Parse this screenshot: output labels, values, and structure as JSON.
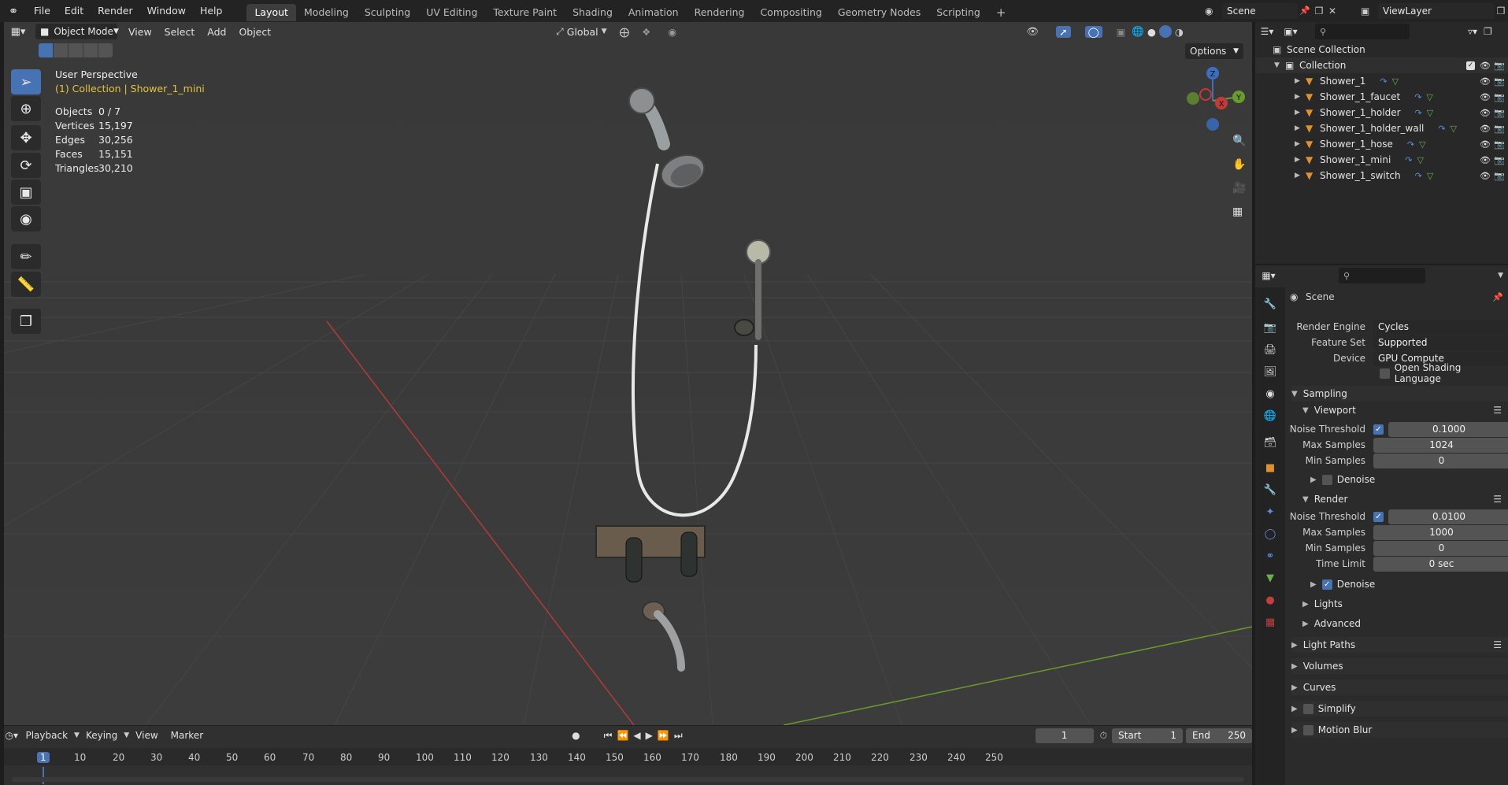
{
  "menu": {
    "items": [
      "File",
      "Edit",
      "Render",
      "Window",
      "Help"
    ]
  },
  "workspaces": {
    "tabs": [
      "Layout",
      "Modeling",
      "Sculpting",
      "UV Editing",
      "Texture Paint",
      "Shading",
      "Animation",
      "Rendering",
      "Compositing",
      "Geometry Nodes",
      "Scripting"
    ],
    "add": "+"
  },
  "scene": {
    "name": "Scene"
  },
  "view_layer": {
    "name": "ViewLayer"
  },
  "viewport_header": {
    "mode": "Object Mode",
    "view": "View",
    "select": "Select",
    "add": "Add",
    "object": "Object",
    "orientation": "Global",
    "options": "Options"
  },
  "overlay_text": {
    "perspective": "User Perspective",
    "context": "(1) Collection | Shower_1_mini"
  },
  "stats": [
    {
      "label": "Objects",
      "value": "0 / 7"
    },
    {
      "label": "Vertices",
      "value": "15,197"
    },
    {
      "label": "Edges",
      "value": "30,256"
    },
    {
      "label": "Faces",
      "value": "15,151"
    },
    {
      "label": "Triangles",
      "value": "30,210"
    }
  ],
  "gizmo": {
    "z": "Z",
    "y": "Y",
    "x": "X"
  },
  "outliner": {
    "root": "Scene Collection",
    "collection": "Collection",
    "objects": [
      "Shower_1",
      "Shower_1_faucet",
      "Shower_1_holder",
      "Shower_1_holder_wall",
      "Shower_1_hose",
      "Shower_1_mini",
      "Shower_1_switch"
    ]
  },
  "properties": {
    "context": "Scene",
    "render_engine_label": "Render Engine",
    "render_engine": "Cycles",
    "feature_set_label": "Feature Set",
    "feature_set": "Supported",
    "device_label": "Device",
    "device": "GPU Compute",
    "osl": "Open Shading Language",
    "sampling": "Sampling",
    "viewport": {
      "title": "Viewport",
      "noise_threshold_label": "Noise Threshold",
      "noise_threshold": "0.1000",
      "max_samples_label": "Max Samples",
      "max_samples": "1024",
      "min_samples_label": "Min Samples",
      "min_samples": "0",
      "denoise": "Denoise"
    },
    "render": {
      "title": "Render",
      "noise_threshold_label": "Noise Threshold",
      "noise_threshold": "0.0100",
      "max_samples_label": "Max Samples",
      "max_samples": "1000",
      "min_samples_label": "Min Samples",
      "min_samples": "0",
      "time_limit_label": "Time Limit",
      "time_limit": "0 sec",
      "denoise": "Denoise"
    },
    "lights": "Lights",
    "advanced": "Advanced",
    "light_paths": "Light Paths",
    "volumes": "Volumes",
    "curves": "Curves",
    "simplify": "Simplify",
    "motion_blur": "Motion Blur"
  },
  "timeline": {
    "playback": "Playback",
    "keying": "Keying",
    "view": "View",
    "marker": "Marker",
    "current_frame": "1",
    "start_label": "Start",
    "start": "1",
    "end_label": "End",
    "end": "250",
    "ticks": [
      "1",
      "10",
      "20",
      "30",
      "40",
      "50",
      "60",
      "70",
      "80",
      "90",
      "100",
      "110",
      "120",
      "130",
      "140",
      "150",
      "160",
      "170",
      "180",
      "190",
      "200",
      "210",
      "220",
      "230",
      "240",
      "250"
    ]
  },
  "colors": {
    "accent": "#4772b3",
    "context_yellow": "#e3c53b",
    "x_axis": "#c23b3b",
    "y_axis": "#6a9b2e"
  }
}
